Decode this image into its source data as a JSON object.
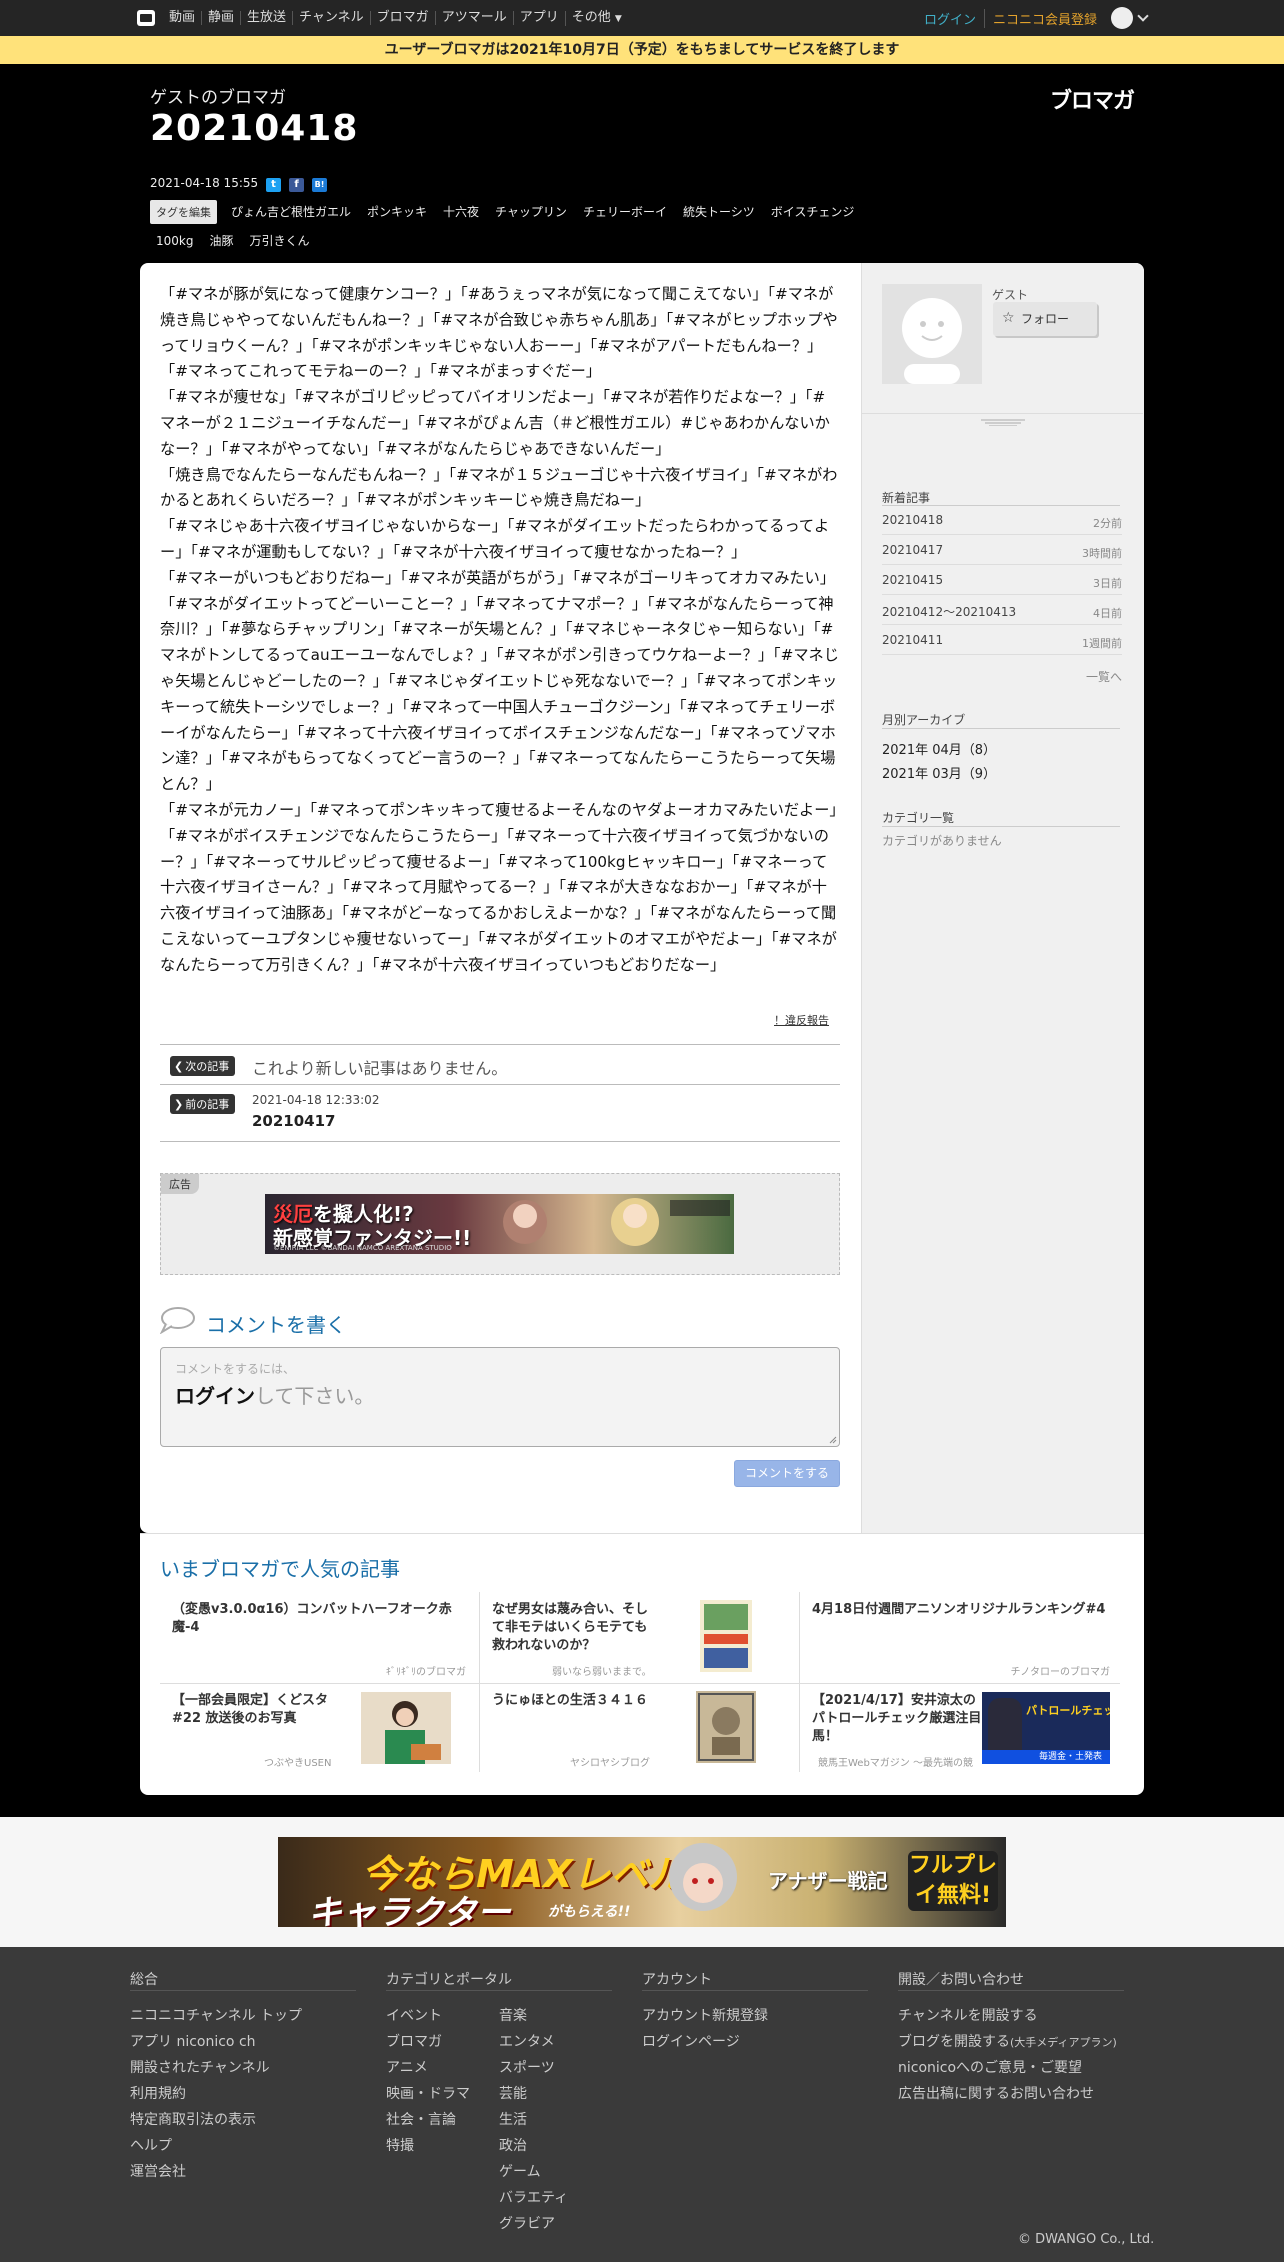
{
  "topnav": {
    "links": [
      "動画",
      "静画",
      "生放送",
      "チャンネル",
      "ブロマガ",
      "アツマール",
      "アプリ",
      "その他"
    ],
    "login": "ログイン",
    "register": "ニコニコ会員登録"
  },
  "notice": "ユーザーブロマガは2021年10月7日（予定）をもちましてサービスを終了します",
  "header": {
    "blog_name": "ゲストのブロマガ",
    "title": "20210418",
    "logo": "ブロマガ",
    "date": "2021-04-18 15:55",
    "share": [
      "t",
      "f",
      "B!"
    ],
    "tag_edit": "タグを編集",
    "tags": [
      "ぴょん吉ど根性ガエル",
      "ポンキッキ",
      "十六夜",
      "チャップリン",
      "チェリーボーイ",
      "統失トーシツ",
      "ボイスチェンジ",
      "100kg",
      "油豚",
      "万引きくん"
    ]
  },
  "article": {
    "paragraphs": [
      "「#マネが豚が気になって健康ケンコー？」「#あうぇっマネが気になって聞こえてない」「#マネが焼き鳥じゃやってないんだもんねー？」「#マネが合致じゃ赤ちゃん肌あ」「#マネがヒップホップやってリョウくーん？」「#マネがポンキッキじゃない人おーー」「#マネがアパートだもんねー？」「#マネってこれってモテねーのー？」「#マネがまっすぐだー」",
      "「#マネが痩せな」「#マネがゴリピッピってバイオリンだよー」「#マネが若作りだよなー？」「#マネーが２１ニジューイチなんだー」「#マネがぴょん吉（＃ど根性ガエル）#じゃあわかんないかなー？」「#マネがやってない」「#マネがなんたらじゃあできないんだー」",
      "「焼き鳥でなんたらーなんだもんねー？」「#マネが１５ジューゴじゃ十六夜イザヨイ」「#マネがわかるとあれくらいだろー？」「#マネがポンキッキーじゃ焼き鳥だねー」",
      "「#マネじゃあ十六夜イザヨイじゃないからなー」「#マネがダイエットだったらわかってるってよー」「#マネが運動もしてない？」「#マネが十六夜イザヨイって痩せなかったねー？」",
      "「#マネーがいつもどおりだねー」「#マネが英語がちがう」「#マネがゴーリキってオカマみたい」「#マネがダイエットってどーいーことー？」「#マネってナマポー？」「#マネがなんたらーって神奈川？」「#夢ならチャップリン」「#マネーが矢場とん？」「#マネじゃーネタじゃー知らない」「#マネがトンしてるってauエーユーなんでしょ？」「#マネがポン引きってウケねーよー？」「#マネじゃ矢場とんじゃどーしたのー？」「#マネじゃダイエットじゃ死なないでー？」「#マネってポンキッキーって統失トーシツでしょー？」「#マネって一中国人チューゴクジーン」「#マネってチェリーボーイがなんたらー」「#マネって十六夜イザヨイってボイスチェンジなんだなー」「#マネってゾマホン達？」「#マネがもらってなくってどー言うのー？」「#マネーってなんたらーこうたらーって矢場とん？」",
      "「#マネが元カノー」「#マネってポンキッキって痩せるよーそんなのヤダよーオカマみたいだよー」「#マネがボイスチェンジでなんたらこうたらー」「#マネーって十六夜イザヨイって気づかないのー？」「#マネーってサルピッピって痩せるよー」「#マネって100kgヒャッキロー」「#マネーって十六夜イザヨイさーん？」「#マネって月賦やってるー？」「#マネが大きななおかー」「#マネが十六夜イザヨイって油豚あ」「#マネがどーなってるかおしえよーかな？」「#マネがなんたらーって聞こえないってーユプタンじゃ痩せないってー」「#マネがダイエットのオマエがやだよー」「#マネがなんたらーって万引きくん？」「#マネが十六夜イザヨイっていつもどおりだなー」"
    ],
    "report": "！違反報告",
    "next_label": "次の記事",
    "next_text": "これより新しい記事はありません。",
    "prev_label": "前の記事",
    "prev_date": "2021-04-18 12:33:02",
    "prev_title": "20210417"
  },
  "ad": {
    "label": "広告",
    "line1_red": "災厄",
    "line1": "を擬人化!?",
    "line2": "新感覚ファンタジー!!",
    "credit": "©ENIRIA LLC ©BANDAI NAMCO AREXTANA STUDIO"
  },
  "comment": {
    "heading": "コメントを書く",
    "hint1": "コメントをするには、",
    "hint_login": "ログイン",
    "hint_rest": "して下さい。",
    "submit": "コメントをする"
  },
  "sidebar": {
    "guest": "ゲスト",
    "follow": "フォロー",
    "recent_heading": "新着記事",
    "recent": [
      {
        "title": "20210418",
        "ago": "2分前"
      },
      {
        "title": "20210417",
        "ago": "3時間前"
      },
      {
        "title": "20210415",
        "ago": "3日前"
      },
      {
        "title": "20210412～20210413",
        "ago": "4日前"
      },
      {
        "title": "20210411",
        "ago": "1週間前"
      }
    ],
    "more": "一覧へ",
    "archive_heading": "月別アーカイブ",
    "archive": [
      "2021年 04月（8）",
      "2021年 03月（9）"
    ],
    "category_heading": "カテゴリ一覧",
    "category_empty": "カテゴリがありません"
  },
  "popular": {
    "heading": "いまブロマガで人気の記事",
    "items": [
      {
        "title": "（変愚v3.0.0α16）コンバットハーフオーク赤魔-4",
        "source": "ｷﾞﾘｷﾞﾘのブロマガ"
      },
      {
        "title": "なぜ男女は蔑み合い、そして非モテはいくらモテても救われないのか？",
        "source": "弱いなら弱いままで。"
      },
      {
        "title": "4月18日付週間アニソンオリジナルランキング#4",
        "source": "チノタローのブロマガ"
      },
      {
        "title": "【一部会員限定】くどスタ#22 放送後のお写真",
        "source": "つぶやきUSEN"
      },
      {
        "title": "うにゅほとの生活３４１６",
        "source": "ヤシロヤシブログ"
      },
      {
        "title": "【2021/4/17】安井涼太のパトロールチェック厳選注目馬！",
        "source": "競馬王Webマガジン ～最先端の競"
      }
    ],
    "thumb6_top": "パトロールチェック",
    "thumb6_bottom": "毎週金・土発表"
  },
  "bottom_ad": {
    "line1": "今ならMAXレベルの",
    "line2": "キャラクター",
    "sub": "がもらえる!!",
    "game": "アナザー戦記",
    "badge": "フルプレイ無料!"
  },
  "footer": {
    "col1_heading": "総合",
    "col1": [
      "ニコニコチャンネル トップ",
      "アプリ niconico ch",
      "開設されたチャンネル",
      "利用規約",
      "特定商取引法の表示",
      "ヘルプ",
      "運営会社"
    ],
    "col2_heading": "カテゴリとポータル",
    "col2a": [
      "イベント",
      "ブロマガ",
      "アニメ",
      "映画・ドラマ",
      "社会・言論",
      "特撮"
    ],
    "col2b": [
      "音楽",
      "エンタメ",
      "スポーツ",
      "芸能",
      "生活",
      "政治",
      "ゲーム",
      "バラエティ",
      "グラビア"
    ],
    "col3_heading": "アカウント",
    "col3": [
      "アカウント新規登録",
      "ログインページ"
    ],
    "col4_heading": "開設／お問い合わせ",
    "col4a": "チャンネルを開設する",
    "col4b": "ブログを開設する",
    "col4b_small": "(大手メディアプラン)",
    "col4c": "niconicoへのご意見・ご要望",
    "col4d": "広告出稿に関するお問い合わせ",
    "copyright": "© DWANGO Co., Ltd."
  },
  "colors": {
    "accent": "#1a6fa8",
    "notice": "#ffe27a",
    "login": "#41b0c8",
    "register": "#e3a22c"
  }
}
